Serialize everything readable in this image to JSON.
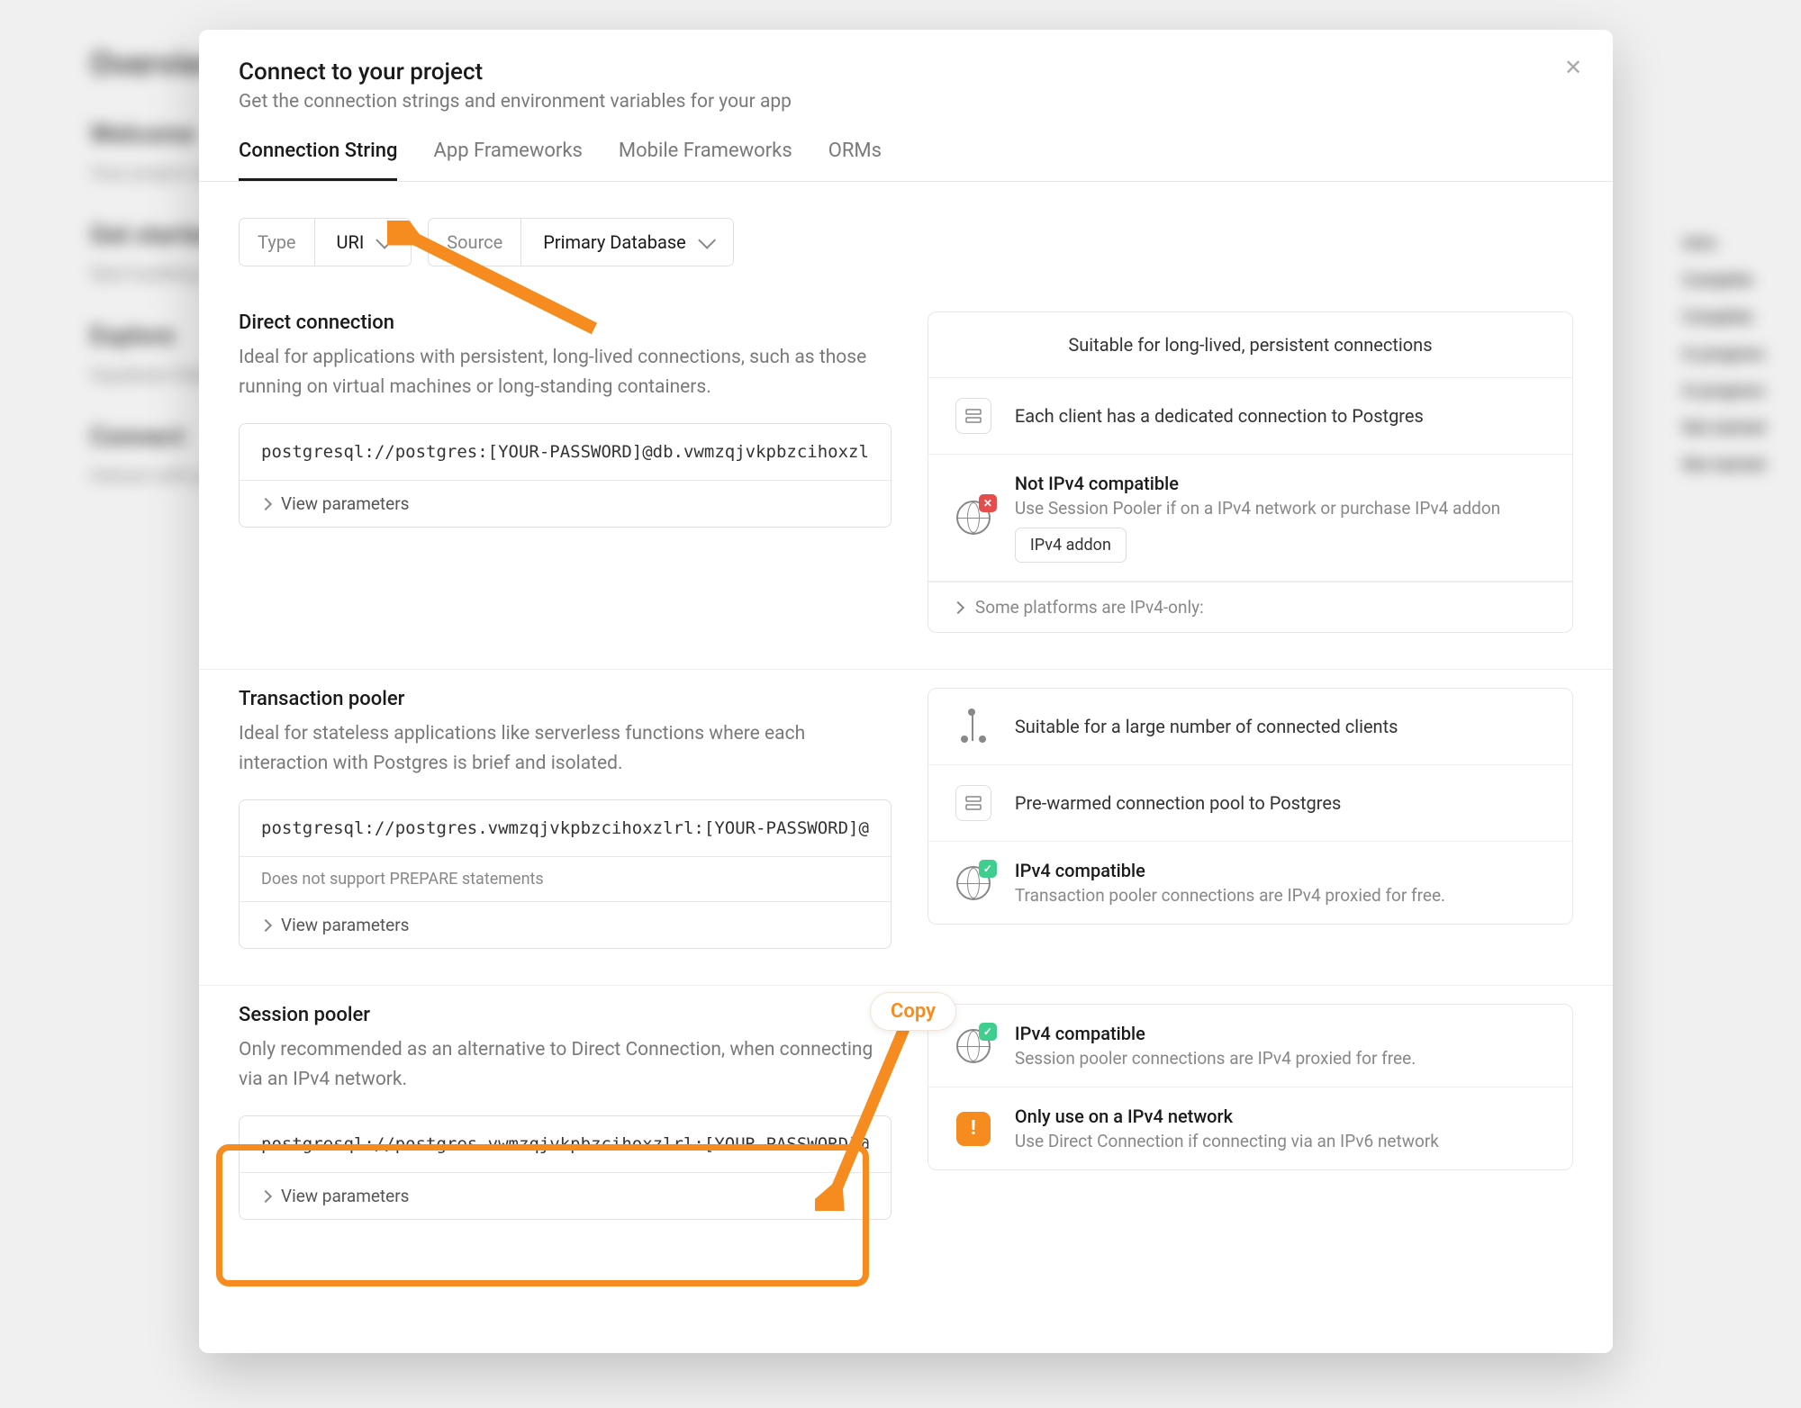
{
  "modal": {
    "title": "Connect to your project",
    "subtitle": "Get the connection strings and environment variables for your app",
    "tabs": [
      "Connection String",
      "App Frameworks",
      "Mobile Frameworks",
      "ORMs"
    ],
    "type_label": "Type",
    "type_value": "URI",
    "source_label": "Source",
    "source_value": "Primary Database"
  },
  "direct": {
    "title": "Direct connection",
    "desc": "Ideal for applications with persistent, long-lived connections, such as those running on virtual machines or long-standing containers.",
    "conn": "postgresql://postgres:[YOUR-PASSWORD]@db.vwmzqjvkpbzcihoxzl",
    "view": "View parameters",
    "info1": "Suitable for long-lived, persistent connections",
    "info2": "Each client has a dedicated connection to Postgres",
    "info3_title": "Not IPv4 compatible",
    "info3_sub": "Use Session Pooler if on a IPv4 network or purchase IPv4 addon",
    "addon": "IPv4 addon",
    "platforms": "Some platforms are IPv4-only:"
  },
  "transaction": {
    "title": "Transaction pooler",
    "desc": "Ideal for stateless applications like serverless functions where each interaction with Postgres is brief and isolated.",
    "conn": "postgresql://postgres.vwmzqjvkpbzcihoxzlrl:[YOUR-PASSWORD]@",
    "note": "Does not support PREPARE statements",
    "view": "View parameters",
    "info1": "Suitable for a large number of connected clients",
    "info2": "Pre-warmed connection pool to Postgres",
    "info3_title": "IPv4 compatible",
    "info3_sub": "Transaction pooler connections are IPv4 proxied for free."
  },
  "session": {
    "title": "Session pooler",
    "desc": "Only recommended as an alternative to Direct Connection, when connecting via an IPv4 network.",
    "conn": "postgresql://postgres.vwmzqjvkpbzcihoxzlrl:[YOUR-PASSWORD]@",
    "view": "View parameters",
    "info1_title": "IPv4 compatible",
    "info1_sub": "Session pooler connections are IPv4 proxied for free.",
    "info2_title": "Only use on a IPv4 network",
    "info2_sub": "Use Direct Connection if connecting via an IPv6 network"
  },
  "annotations": {
    "copy": "Copy"
  },
  "bg": {
    "statuses": [
      "Intro",
      "Complete",
      "Complete",
      "In progress",
      "In progress",
      "Not started",
      "Not started"
    ]
  }
}
